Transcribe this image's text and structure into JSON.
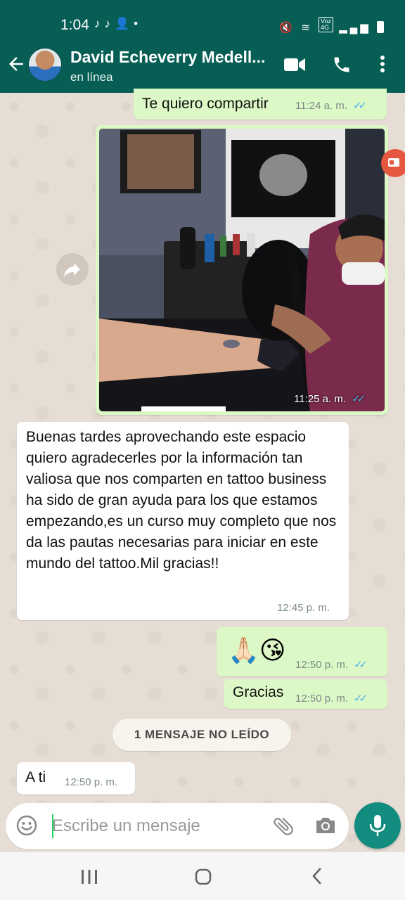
{
  "status_bar": {
    "time": "1:04",
    "notification_icons": [
      "tiktok-icon",
      "tiktok-icon",
      "contact-request-icon",
      "dot"
    ],
    "system_icons": [
      "mute-icon",
      "wifi-icon",
      "volte-4g-icon",
      "signal-icon",
      "battery-icon"
    ],
    "volte_label_top": "Voz",
    "volte_label_bottom": "4G"
  },
  "header": {
    "contact_name": "David Echeverry Medell...",
    "status": "en línea",
    "actions": [
      "video-call-icon",
      "voice-call-icon",
      "more-options-icon"
    ]
  },
  "messages": [
    {
      "direction": "out",
      "type": "text",
      "text": "Te quiero compartir",
      "time": "11:24 a. m.",
      "read": true
    },
    {
      "direction": "out",
      "type": "image",
      "time": "11:25 a. m.",
      "read": true
    },
    {
      "direction": "in",
      "type": "text",
      "text": "Buenas tardes aprovechando este espacio quiero agradecerles por la información tan valiosa que  nos comparten en tattoo business ha sido de gran ayuda para los que estamos empezando,es un curso muy completo que nos da las pautas necesarias para iniciar en este mundo del tattoo.Mil gracias!!",
      "time": "12:45 p. m."
    },
    {
      "direction": "out",
      "type": "emoji",
      "text": "🙏🏻😘",
      "time": "12:50 p. m.",
      "read": true
    },
    {
      "direction": "out",
      "type": "text",
      "text": "Gracias",
      "time": "12:50 p. m.",
      "read": true
    },
    {
      "direction": "in",
      "type": "text",
      "text": "A ti",
      "time": "12:50 p. m."
    }
  ],
  "unread_divider": "1 MENSAJE NO LEÍDO",
  "composer": {
    "placeholder": "Escribe un mensaje",
    "icons": [
      "emoji-icon",
      "attach-icon",
      "camera-icon",
      "mic-icon"
    ]
  },
  "nav_bar": [
    "recent-apps-icon",
    "home-icon",
    "back-icon"
  ],
  "colors": {
    "header": "#075e54",
    "outgoing_bubble": "#dcf8c6",
    "incoming_bubble": "#ffffff",
    "read_ticks": "#4fb6ec",
    "mic_button": "#128c7e",
    "chat_background": "#e6ddd4"
  }
}
